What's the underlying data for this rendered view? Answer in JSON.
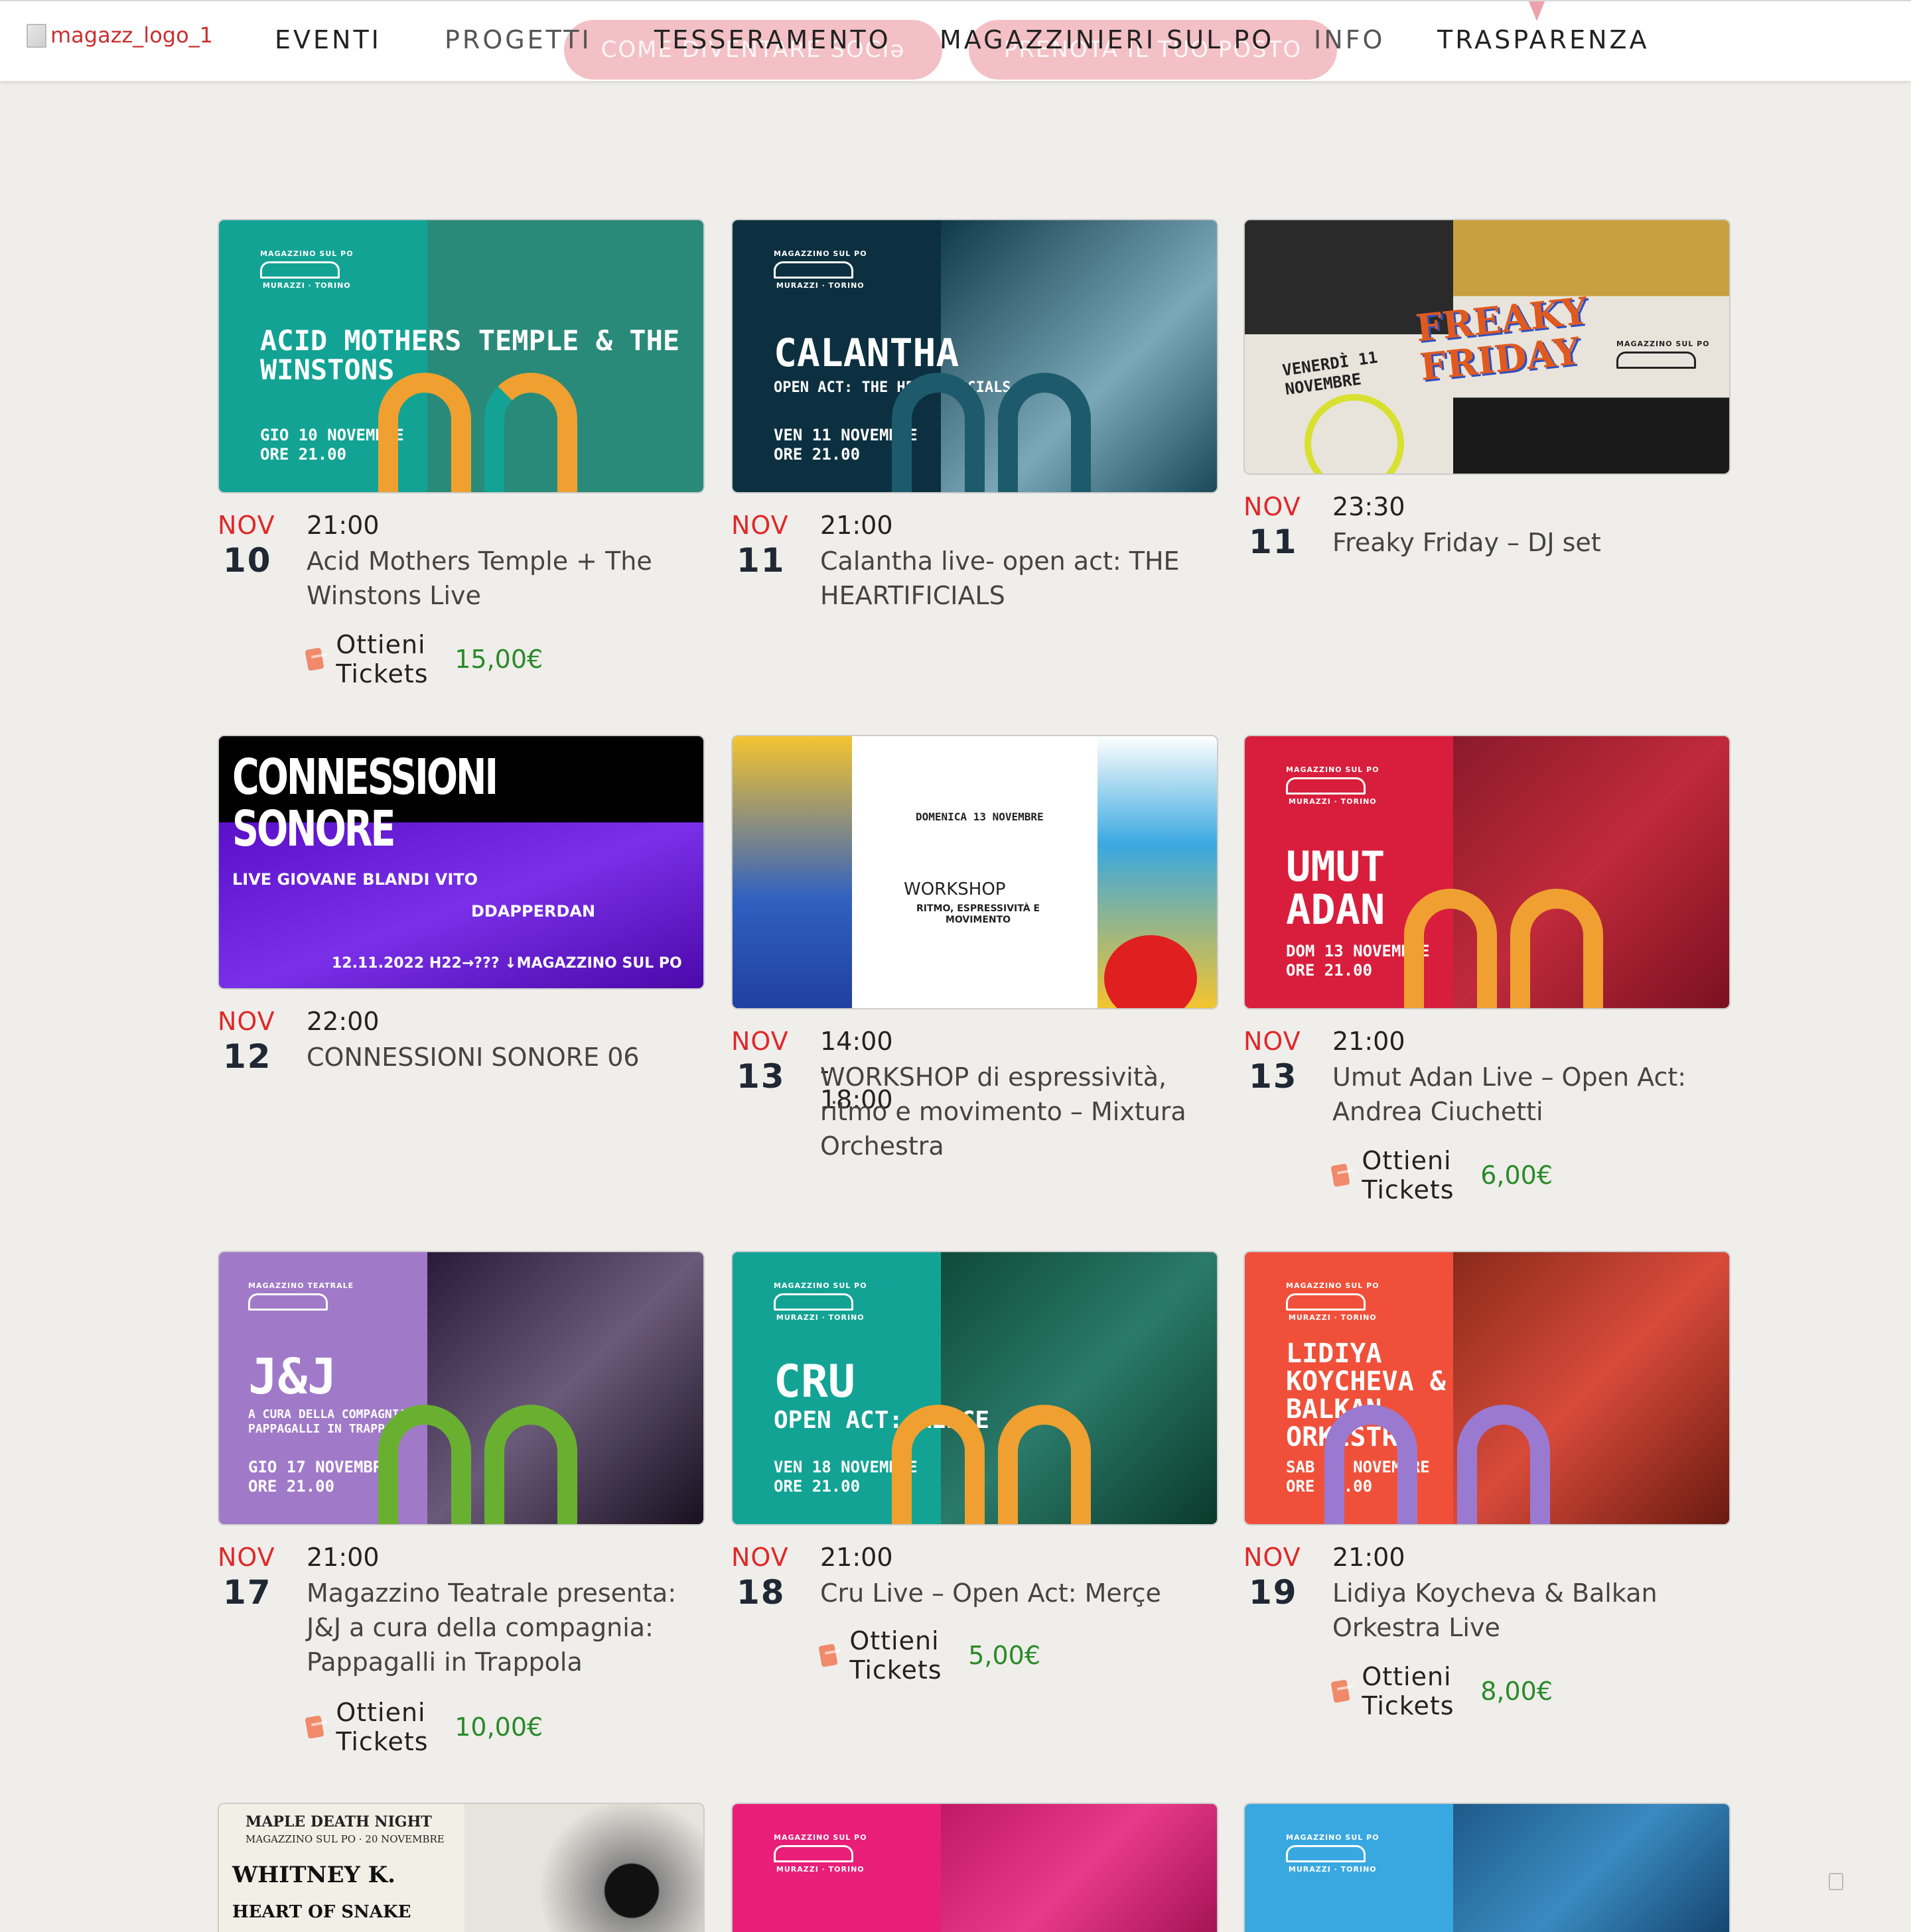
{
  "header": {
    "logo_alt": "magazz_logo_1",
    "nav": [
      {
        "label": "EVENTI"
      },
      {
        "label": "PROGETTI"
      },
      {
        "label": "TESSERAMENTO"
      },
      {
        "label": "MAGAZZINIERI SUL PO"
      },
      {
        "label": "INFO"
      },
      {
        "label": "TRASPARENZA"
      }
    ],
    "pills": [
      "COME DIVENTARE SOCIə",
      "PRENOTA IL TUO POSTO"
    ]
  },
  "events": [
    {
      "month": "NOV",
      "day": "10",
      "time": "21:00",
      "title": "Acid Mothers Temple + The Winstons Live",
      "tickets": "Ottieni Tickets",
      "price": "15,00€",
      "poster": {
        "title": "ACID MOTHERS TEMPLE & THE WINSTONS",
        "date": "GIO 10 NOVEMBRE",
        "hour": "ORE 21.00",
        "color": "#13a394",
        "right": "#2a7a6a",
        "arch": "#f0a030"
      }
    },
    {
      "month": "NOV",
      "day": "11",
      "time": "21:00",
      "title": "Calantha live- open act: THE HEARTIFICIALS",
      "tickets": "",
      "price": "",
      "poster": {
        "title": "CALANTHA",
        "subtitle": "OPEN ACT: THE HEARTIFICIALS",
        "date": "VEN 11 NOVEMBRE",
        "hour": "ORE 21.00",
        "color": "#0f3a4a",
        "right": "#5a8a9a",
        "arch": "#1d5b6c"
      }
    },
    {
      "month": "NOV",
      "day": "11",
      "time": "23:30",
      "title": "Freaky Friday – DJ set",
      "tickets": "",
      "price": "",
      "poster": {
        "title": "FREAKY FRIDAY",
        "date": "VENERDÌ 11 NOVEMBRE",
        "color": "#e8e4dc",
        "right": "#2a2a2a",
        "arch": "#d8e030"
      }
    },
    {
      "month": "NOV",
      "day": "12",
      "time": "22:00",
      "title": "CONNESSIONI SONORE 06",
      "tickets": "",
      "price": "",
      "poster": {
        "title": "CONNESSIONI SONORE",
        "line1": "LIVE  GIOVANE BLANDI   VITO",
        "line2": "DDAPPERDAN",
        "line3": "12.11.2022   H22→???   ↓MAGAZZINO SUL PO",
        "color": "#5a10c8",
        "right": "#6a20d8",
        "arch": "#000000"
      }
    },
    {
      "month": "NOV",
      "day": "13",
      "time": "14:00 - 18:00",
      "title": "WORKSHOP di espressività, ritmo e movimento – Mixtura Orchestra",
      "tickets": "",
      "price": "",
      "poster": {
        "title": "WORKSHOP",
        "subtitle": "RITMO, ESPRESSIVITÀ E MOVIMENTO",
        "date": "DOMENICA 13 NOVEMBRE",
        "color": "#ffffff",
        "right": "#f4c430",
        "arch": "#e02020"
      }
    },
    {
      "month": "NOV",
      "day": "13",
      "time": "21:00",
      "title": "Umut Adan Live – Open Act: Andrea Ciuchetti",
      "tickets": "Ottieni Tickets",
      "price": "6,00€",
      "poster": {
        "title": "UMUT ADAN",
        "date": "DOM 13 NOVEMBRE",
        "hour": "ORE 21.00",
        "color": "#d81e3c",
        "right": "#a82030",
        "arch": "#f0a030"
      }
    },
    {
      "month": "NOV",
      "day": "17",
      "time": "21:00",
      "title": "Magazzino Teatrale presenta: J&J a cura della compagnia: Pappagalli in Trappola",
      "tickets": "Ottieni Tickets",
      "price": "10,00€",
      "poster": {
        "title": "J&J",
        "subtitle": "A CURA DELLA COMPAGNIA PAPPAGALLI IN TRAPPOLA",
        "date": "GIO 17 NOVEMBRE",
        "hour": "ORE 21.00",
        "color": "#a07ac8",
        "right": "#1a1a2a",
        "arch": "#6ab030"
      }
    },
    {
      "month": "NOV",
      "day": "18",
      "time": "21:00",
      "title": "Cru Live – Open Act: Merçe",
      "tickets": "Ottieni Tickets",
      "price": "5,00€",
      "poster": {
        "title": "CRU",
        "subtitle": "OPEN ACT: MERÇE",
        "date": "VEN 18 NOVEMBRE",
        "hour": "ORE 21.00",
        "color": "#13a394",
        "right": "#1a5a4a",
        "arch": "#f0a030"
      }
    },
    {
      "month": "NOV",
      "day": "19",
      "time": "21:00",
      "title": "Lidiya Koycheva & Balkan Orkestra Live",
      "tickets": "Ottieni Tickets",
      "price": "8,00€",
      "poster": {
        "title": "LIDIYA KOYCHEVA & BALKAN ORKESTRA",
        "date": "SAB 19 NOVEMBRE",
        "hour": "ORE 21.00",
        "color": "#f0503a",
        "right": "#c83a2a",
        "arch": "#9a7ad0"
      }
    }
  ],
  "partial_posters": [
    {
      "title": "WHITNEY K.",
      "subtitle": "HEART OF SNAKE",
      "top": "MAPLE DEATH NIGHT",
      "sub": "MAGAZZINO SUL PO · 20 NOVEMBRE",
      "color": "#f2efe6",
      "right": "#dedad0"
    },
    {
      "title": "",
      "color": "#e81e78",
      "right": "#d02070"
    },
    {
      "title": "",
      "color": "#3aa8e0",
      "right": "#1e6a9a"
    }
  ]
}
